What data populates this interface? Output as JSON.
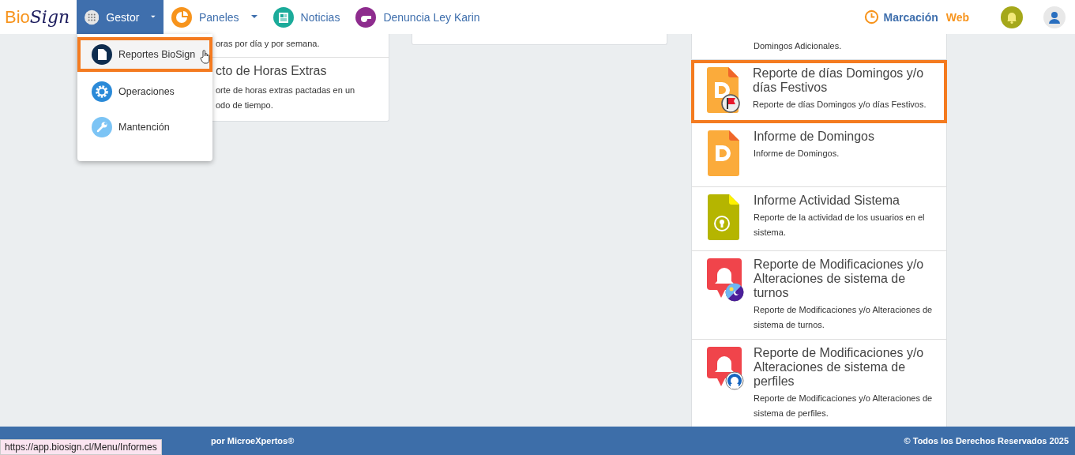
{
  "logo": {
    "first": "Bio",
    "second": "Sign"
  },
  "nav": [
    {
      "kind": "grid",
      "label": "Gestor",
      "caret": true,
      "selected": true
    },
    {
      "kind": "pie",
      "label": "Paneles",
      "caret": true,
      "selected": false
    },
    {
      "kind": "news",
      "label": "Noticias",
      "caret": false,
      "selected": false
    },
    {
      "kind": "whistle",
      "label": "Denuncia Ley Karin",
      "caret": false,
      "selected": false
    }
  ],
  "clock_link": {
    "first": "Marcación",
    "second": "Web"
  },
  "dropdown": [
    {
      "kind": "doc",
      "label": "Reportes BioSign",
      "highlighted": true
    },
    {
      "kind": "gear",
      "label": "Operaciones",
      "highlighted": false
    },
    {
      "kind": "wrench",
      "label": "Mantención",
      "highlighted": false
    }
  ],
  "left_card": {
    "rows": [
      {
        "description": [
          "oras por día y por semana."
        ]
      },
      {
        "title": "cto de Horas Extras",
        "description": [
          "orte de horas extras pactadas en un",
          "odo de tiempo."
        ]
      }
    ]
  },
  "right_card": {
    "rows": [
      {
        "kind": "text-only",
        "description": "Domingos Adicionales.",
        "highlighted": false
      },
      {
        "kind": "doc-d-flag",
        "title": "Reporte de días Domingos y/o días Festivos",
        "description": "Reporte de días Domingos y/o días Festivos.",
        "highlighted": true
      },
      {
        "kind": "doc-d",
        "title": "Informe de Domingos",
        "description": "Informe de Domingos.",
        "highlighted": false
      },
      {
        "kind": "doc-lock",
        "title": "Informe Actividad Sistema",
        "description": "Reporte de la actividad de los usuarios en el sistema.",
        "highlighted": false
      },
      {
        "kind": "bell-daynight",
        "title": "Reporte de Modificaciones y/o Alteraciones de sistema de turnos",
        "description": "Reporte de Modificaciones y/o Alteraciones de sistema de turnos.",
        "highlighted": false
      },
      {
        "kind": "bell-user",
        "title": "Reporte de Modificaciones y/o Alteraciones de sistema de perfiles",
        "description": "Reporte de Modificaciones y/o Alteraciones de sistema de perfiles.",
        "highlighted": false
      }
    ]
  },
  "footer": {
    "left": "por MicroeXpertos®",
    "right": "© Todos los Derechos Reservados 2025"
  },
  "status_url": "https://app.biosign.cl/Menu/Informes"
}
